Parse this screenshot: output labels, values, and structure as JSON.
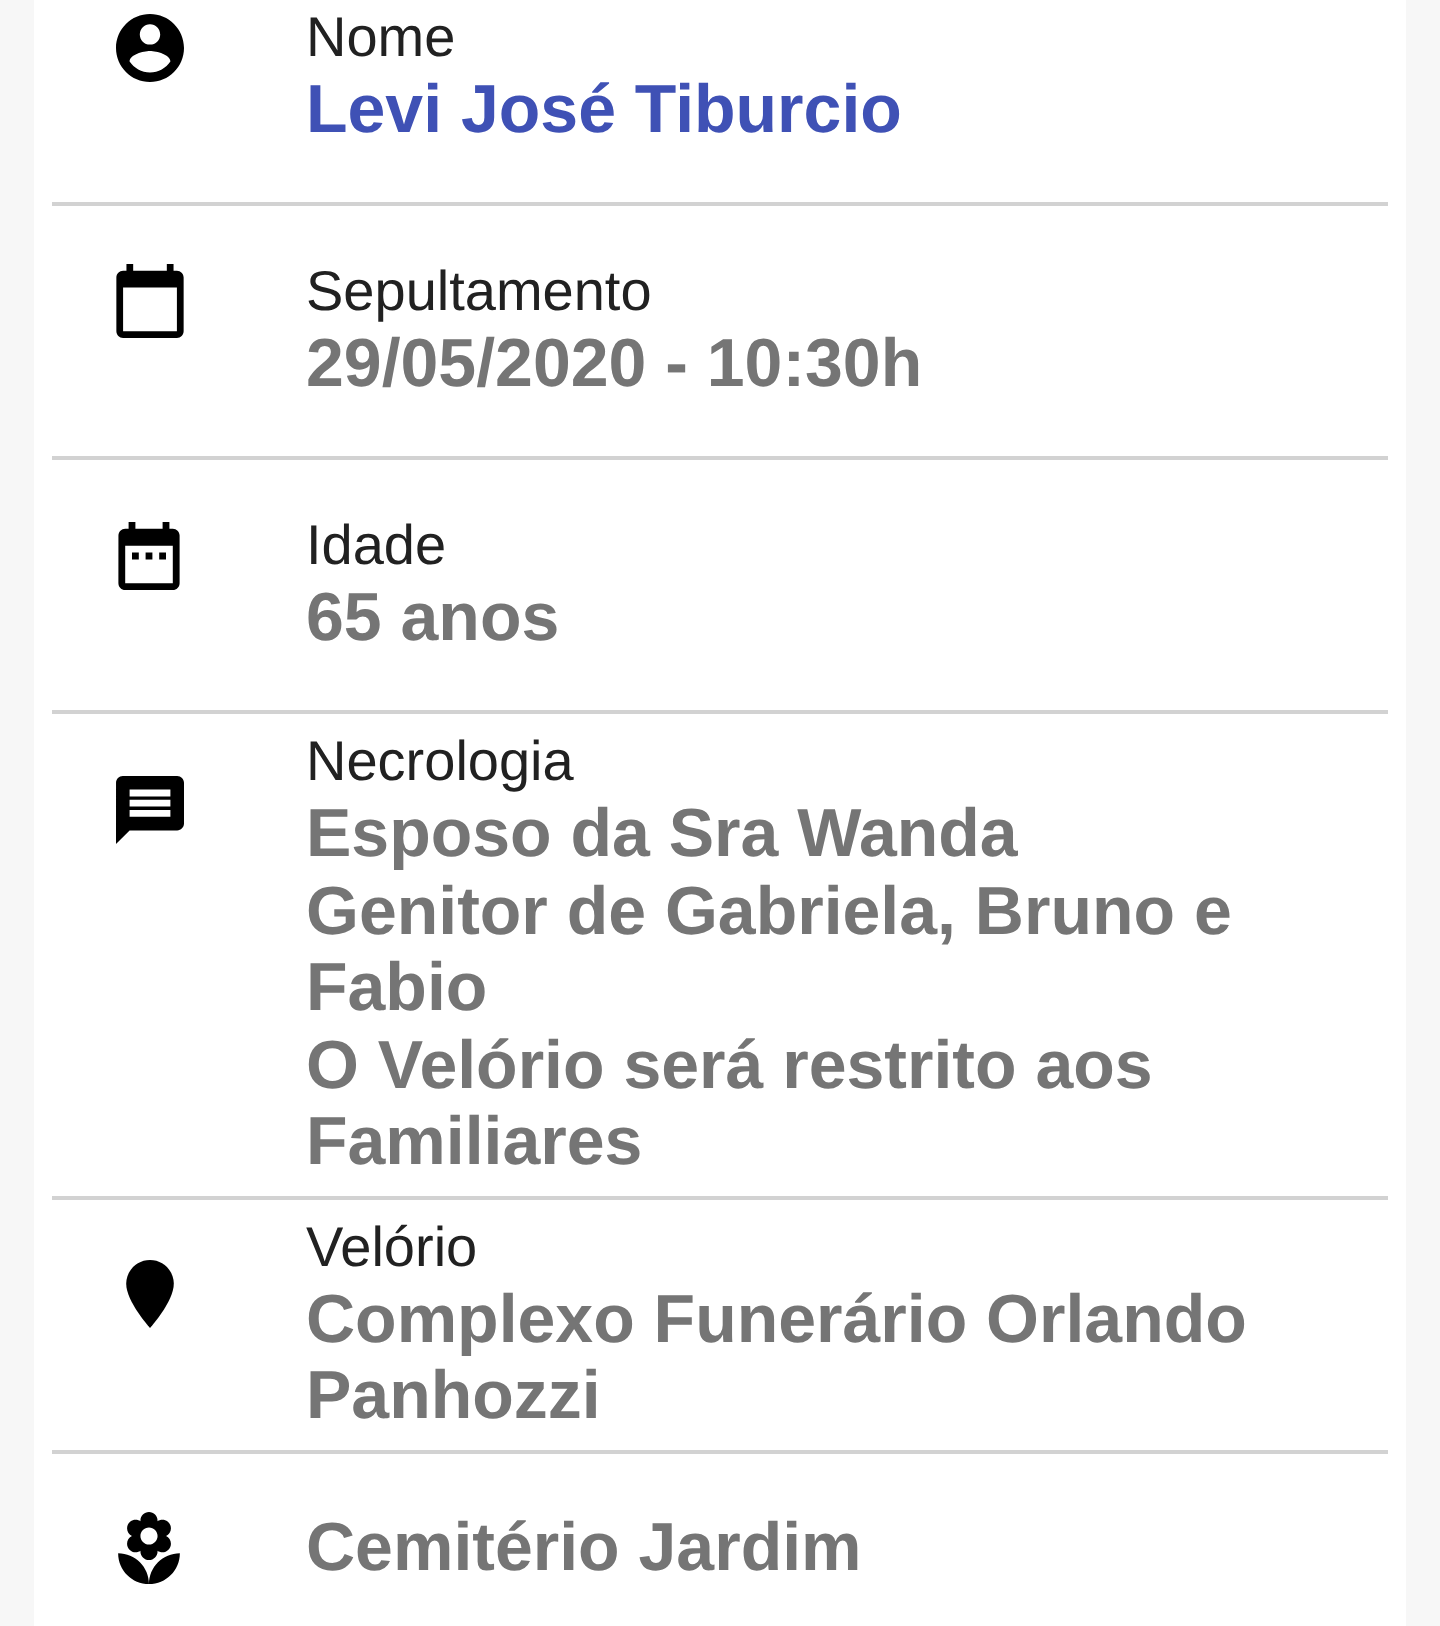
{
  "items": [
    {
      "label": "Nome",
      "kind": "name",
      "value_lines": [
        "Levi José Tiburcio"
      ]
    },
    {
      "label": "Sepultamento",
      "kind": "detail",
      "value_lines": [
        "29/05/2020 - 10:30h"
      ]
    },
    {
      "label": "Idade",
      "kind": "detail",
      "value_lines": [
        "65 anos"
      ]
    },
    {
      "label": "Necrologia",
      "kind": "detail",
      "value_lines": [
        "Esposo da Sra Wanda",
        "Genitor de Gabriela, Bruno e",
        "Fabio",
        "O Velório será restrito aos",
        "Familiares"
      ]
    },
    {
      "label": "Velório",
      "kind": "detail",
      "value_lines": [
        "Complexo Funerário Orlando",
        "Panhozzi"
      ]
    },
    {
      "kind": "detail",
      "value_lines": [
        "Cemitério Jardim"
      ]
    }
  ]
}
